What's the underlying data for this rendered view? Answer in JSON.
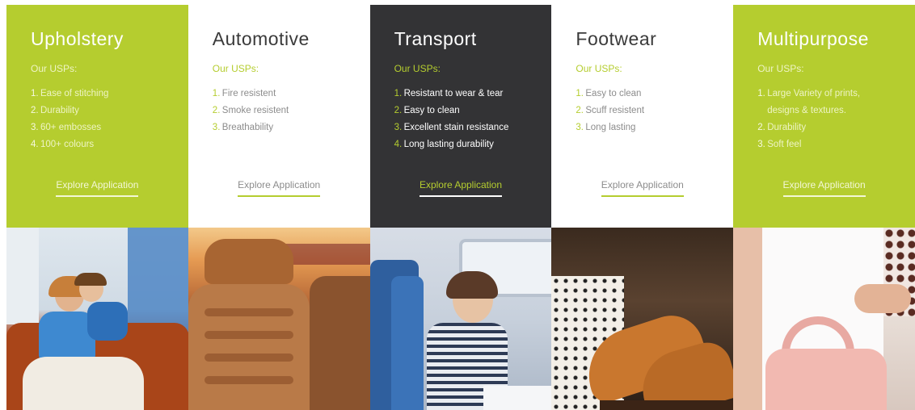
{
  "cards": [
    {
      "title": "Upholstery",
      "usps_label": "Our USPs:",
      "items": [
        "Ease of stitching",
        "Durability",
        "60+ embosses",
        "100+ colours"
      ],
      "cta": "Explore Application",
      "image_icon": "family-on-sofa-photo"
    },
    {
      "title": "Automotive",
      "usps_label": "Our USPs:",
      "items": [
        "Fire resistent",
        "Smoke resistent",
        "Breathability"
      ],
      "cta": "Explore Application",
      "image_icon": "car-seat-photo"
    },
    {
      "title": "Transport",
      "usps_label": "Our USPs:",
      "items": [
        "Resistant to wear & tear",
        "Easy to clean",
        "Excellent stain resistance",
        "Long lasting durability"
      ],
      "cta": "Explore Application",
      "image_icon": "train-passenger-photo"
    },
    {
      "title": "Footwear",
      "usps_label": "Our USPs:",
      "items": [
        "Easy to clean",
        "Scuff resistent",
        "Long lasting"
      ],
      "cta": "Explore Application",
      "image_icon": "leather-shoes-photo"
    },
    {
      "title": "Multipurpose",
      "usps_label": "Our USPs:",
      "items": [
        "Large Variety of prints, designs & textures.",
        "Durability",
        "Soft feel"
      ],
      "cta": "Explore Application",
      "image_icon": "handbag-photo"
    }
  ],
  "colors": {
    "accent_green": "#b5cd2f",
    "dark": "#333335",
    "white": "#ffffff",
    "muted_text": "#8c8c8c"
  }
}
